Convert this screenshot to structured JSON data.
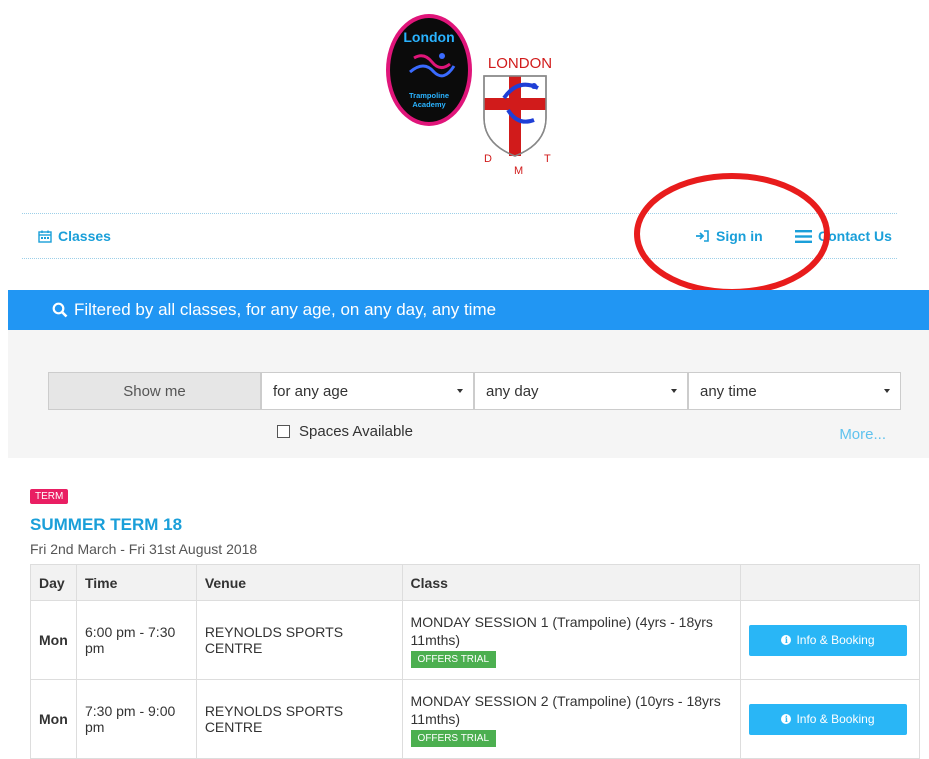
{
  "logos": {
    "left": {
      "line1": "London",
      "line2": "Trampoline",
      "line3": "Academy"
    },
    "right": {
      "title": "LONDON",
      "l1": "D",
      "l2": "M",
      "l3": "T"
    }
  },
  "nav": {
    "classes_label": "Classes",
    "signin_label": "Sign in",
    "contact_label": "Contact Us"
  },
  "filter": {
    "summary": "Filtered by all classes, for any age, on any day, any time",
    "show_me": "Show me",
    "age": "for any age",
    "day": "any day",
    "time": "any time",
    "spaces_label": "Spaces Available",
    "more_label": "More..."
  },
  "term": {
    "badge": "TERM",
    "title": "SUMMER TERM 18",
    "dates": "Fri 2nd March - Fri 31st August 2018"
  },
  "table": {
    "headers": {
      "day": "Day",
      "time": "Time",
      "venue": "Venue",
      "class": "Class",
      "action": ""
    },
    "rows": [
      {
        "day": "Mon",
        "time": "6:00 pm - 7:30 pm",
        "venue": "REYNOLDS SPORTS CENTRE",
        "class": "MONDAY SESSION 1 (Trampoline) (4yrs - 18yrs 11mths)",
        "badge": "OFFERS TRIAL",
        "button": "Info & Booking"
      },
      {
        "day": "Mon",
        "time": "7:30 pm - 9:00 pm",
        "venue": "REYNOLDS SPORTS CENTRE",
        "class": "MONDAY SESSION 2 (Trampoline) (10yrs - 18yrs 11mths)",
        "badge": "OFFERS TRIAL",
        "button": "Info & Booking"
      }
    ]
  },
  "colors": {
    "brand_blue": "#1a9fd9",
    "banner_blue": "#2196f3",
    "button_blue": "#29b6f6",
    "term_pink": "#e91e63",
    "trial_green": "#4caf50",
    "annotation_red": "#e81c1c"
  }
}
